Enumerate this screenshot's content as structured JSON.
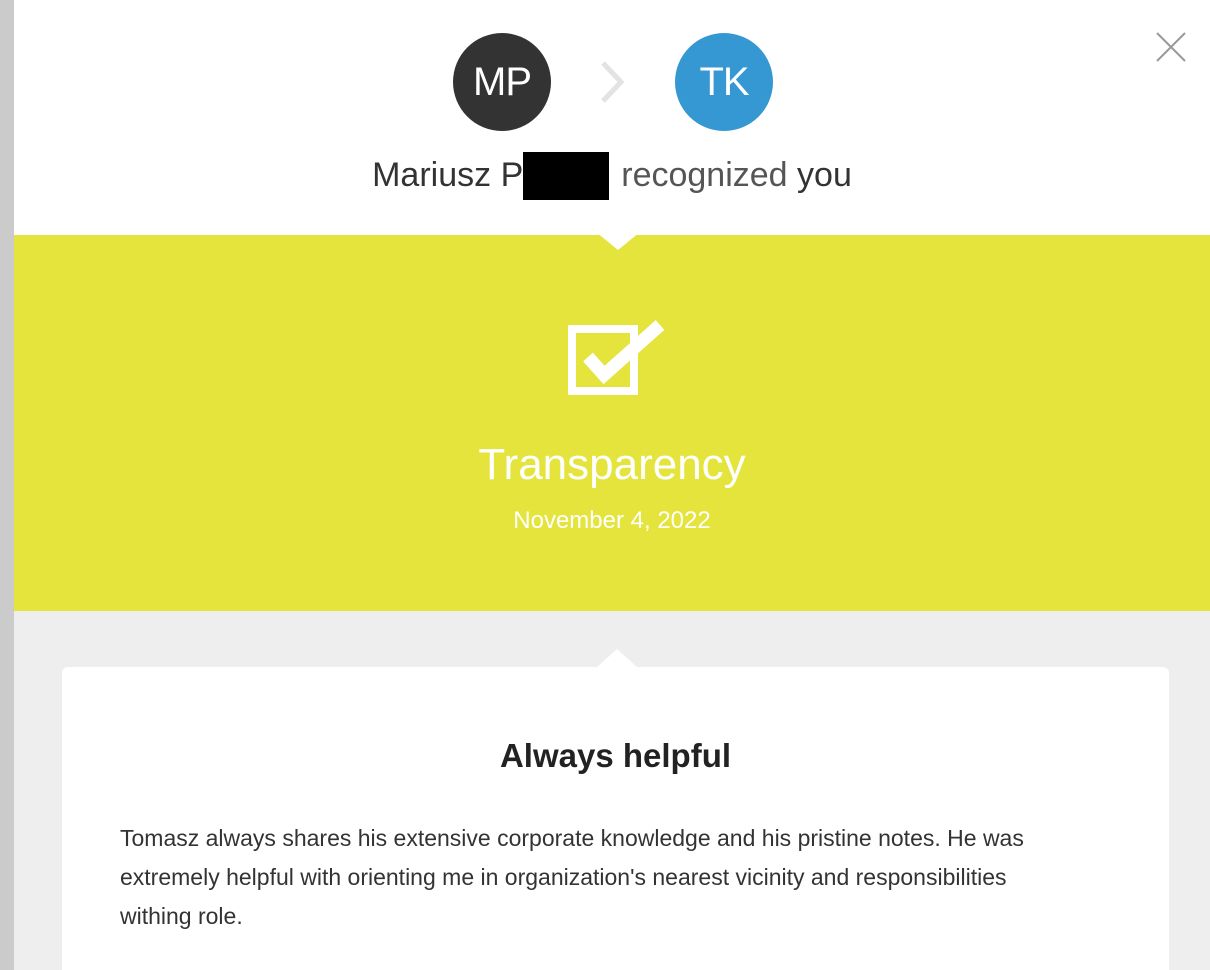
{
  "close_icon": "close-icon",
  "sender": {
    "initials": "MP",
    "color": "#333333"
  },
  "receiver": {
    "initials": "TK",
    "color": "#3598d2"
  },
  "arrow_icon": "chevron-right-icon",
  "headline": {
    "name_visible": "Mariusz P",
    "action": "recognized",
    "target": "you"
  },
  "recognition": {
    "icon": "checkbox-checked-icon",
    "value": "Transparency",
    "date": "November 4, 2022",
    "band_color": "#e4e43c"
  },
  "message": {
    "title": "Always helpful",
    "body": "Tomasz always shares his extensive corporate knowledge and his pristine notes. He was extremely helpful with orienting me in organization's nearest vicinity and responsibilities withing role."
  }
}
